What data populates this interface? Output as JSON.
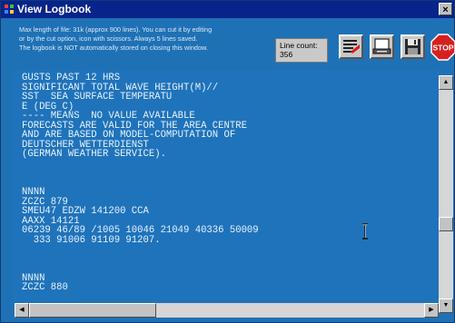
{
  "window": {
    "title": "View Logbook",
    "close_label": "×"
  },
  "info_lines": [
    "Max length of file: 31k (approx 900 lines). You can cut it by editing",
    "or by the cut option, icon with scissors. Always 5 lines saved.",
    "The logbook is NOT automatically stored on closing this window."
  ],
  "line_count": {
    "label": "Line count:",
    "value": "356"
  },
  "toolbar": {
    "buttons": [
      {
        "icon": "cut-lines-icon"
      },
      {
        "icon": "print-icon"
      },
      {
        "icon": "save-icon"
      }
    ],
    "stop_label": "STOP"
  },
  "log_lines": [
    "GUSTS PAST 12 HRS",
    "SIGNIFICANT TOTAL WAVE HEIGHT(M)//",
    "SST  SEA SURFACE TEMPERATU",
    "E (DEG C)",
    "---- MEANS  NO VALUE AVAILABLE",
    "FORECASTS ARE VALID FOR THE AREA CENTRE",
    "AND ARE BASED ON MODEL-COMPUTATION OF",
    "DEUTSCHER WETTERDIENST",
    "(GERMAN WEATHER SERVICE).",
    "",
    "",
    "",
    "NNNN",
    "ZCZC 879",
    "SMEU47 EDZW 141200 CCA",
    "AAXX 14121",
    "06239 46/89 /1005 10046 21049 40336 50009",
    "  333 91006 91109 91207.",
    "",
    "",
    "",
    "NNNN",
    "ZCZC 880"
  ],
  "scrollbar": {
    "up": "▲",
    "down": "▼",
    "left": "◀",
    "right": "▶"
  }
}
